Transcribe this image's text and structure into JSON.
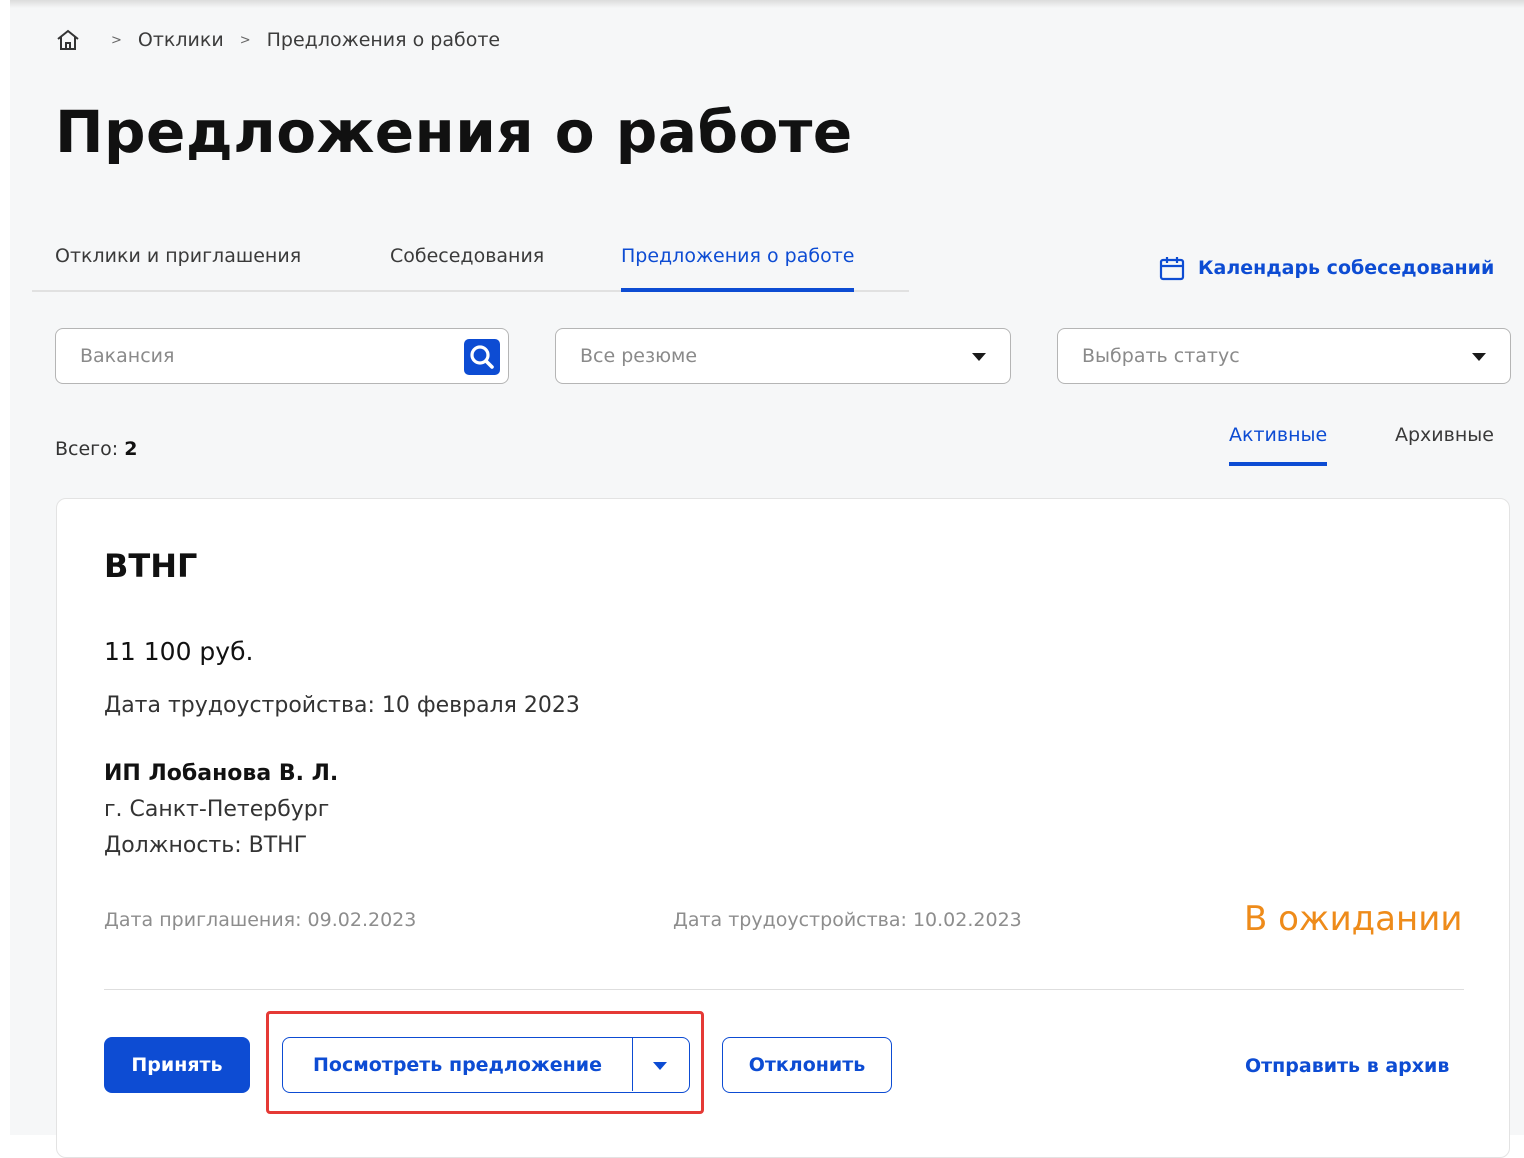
{
  "breadcrumb": {
    "items": [
      "Отклики",
      "Предложения о работе"
    ],
    "separator": ">"
  },
  "page": {
    "title": "Предложения о работе"
  },
  "tabs": [
    {
      "label": "Отклики и приглашения",
      "active": false
    },
    {
      "label": "Собеседования",
      "active": false
    },
    {
      "label": "Предложения о работе",
      "active": true
    }
  ],
  "calendar_link": {
    "label": "Календарь собеседований",
    "icon": "calendar-icon"
  },
  "filters": {
    "vacancy_placeholder": "Вакансия",
    "resume_select": "Все резюме",
    "status_select": "Выбрать статус"
  },
  "summary": {
    "total_label": "Всего:",
    "total_value": "2"
  },
  "subtabs": [
    {
      "label": "Активные",
      "active": true
    },
    {
      "label": "Архивные",
      "active": false
    }
  ],
  "offer": {
    "title": "ВТНГ",
    "salary": "11 100 руб.",
    "start_date": "Дата трудоустройства: 10 февраля 2023",
    "employer": "ИП Лобанова В. Л.",
    "city": "г. Санкт-Петербург",
    "position": "Должность: ВТНГ",
    "invite_date": "Дата приглашения: 09.02.2023",
    "employment_date": "Дата трудоустройства: 10.02.2023",
    "status": "В ожидании",
    "actions": {
      "accept": "Принять",
      "view": "Посмотреть предложение",
      "decline": "Отклонить",
      "archive": "Отправить в архив"
    }
  },
  "colors": {
    "accent": "#0d4cd3",
    "status_pending": "#ee8b1a",
    "highlight": "#e53935"
  }
}
